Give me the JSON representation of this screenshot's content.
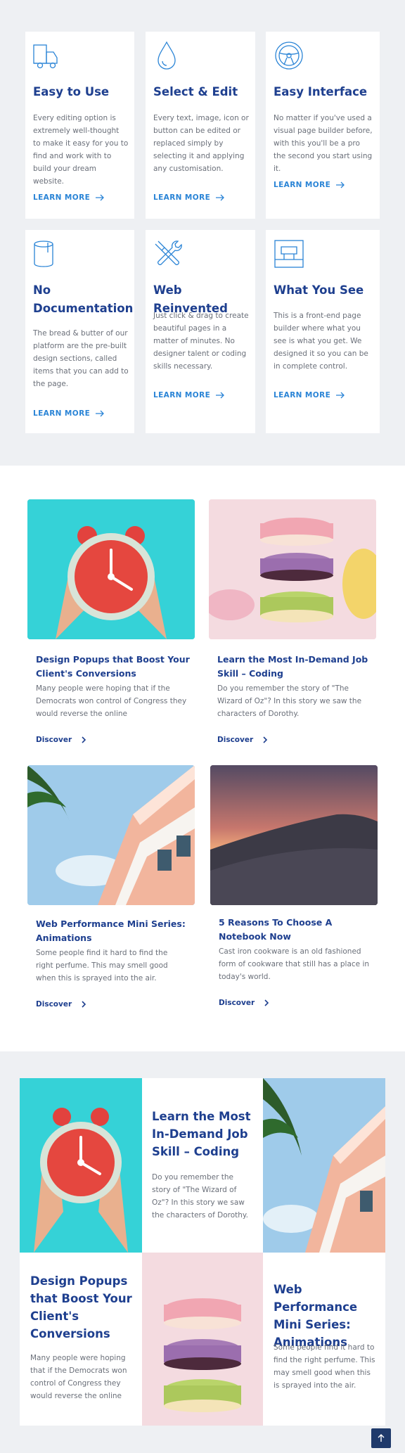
{
  "features": [
    {
      "icon": "truck-icon",
      "title": "Easy to Use",
      "text": "Every editing option is extremely well-thought to make it easy for you to find and work with to build your dream website.",
      "link": "LEARN MORE"
    },
    {
      "icon": "drop-icon",
      "title": "Select & Edit",
      "text": "Every text, image, icon or button can be edited or replaced simply by selecting it and applying any customisation.",
      "link": "LEARN MORE"
    },
    {
      "icon": "steering-wheel-icon",
      "title": "Easy Interface",
      "text": "No matter if you've used a visual page builder before, with this you'll be a pro the second you start using it.",
      "link": "LEARN MORE"
    },
    {
      "icon": "paint-can-icon",
      "title": "No Documentation",
      "text": "The bread & butter of our platform are the pre-built design sections, called items that you can add to the page.",
      "link": "LEARN MORE"
    },
    {
      "icon": "tools-icon",
      "title": "Web Reinvented",
      "text": "Just click & drag to create beautiful pages in a matter of minutes. No designer talent or coding skills necessary.",
      "link": "LEARN MORE"
    },
    {
      "icon": "layout-icon",
      "title": "What You See",
      "text": "This is a front-end page builder where what you see is what you get. We designed it so you can be in complete control.",
      "link": "LEARN MORE"
    }
  ],
  "posts": [
    {
      "image": "alarm-clock-image",
      "title": "Design Popups that Boost Your Client's Conversions",
      "text": "Many people were hoping that if the Democrats won control of Congress they would reverse the online",
      "link": "Discover"
    },
    {
      "image": "macarons-image",
      "title": "Learn the Most In-Demand Job Skill – Coding",
      "text": "Do you remember the story of \"The Wizard of Oz\"? In this story we saw the characters of Dorothy.",
      "link": "Discover"
    },
    {
      "image": "building-palm-image",
      "title": "Web Performance Mini Series: Animations",
      "text": "Some people find it hard to find the right perfume. This may smell good when this is sprayed into the air.",
      "link": "Discover"
    },
    {
      "image": "desert-dune-image",
      "title": "5 Reasons To Choose A Notebook Now",
      "text": "Cast iron cookware is an old fashioned form of cookware that still has a place in today's world.",
      "link": "Discover"
    }
  ],
  "grid": {
    "item1": {
      "title": "Learn the Most In-Demand Job Skill – Coding",
      "text": "Do you remember the story of \"The Wizard of Oz\"? In this story we saw the characters of Dorothy."
    },
    "item2": {
      "title": "Design Popups that Boost Your Client's Conversions",
      "text": "Many people were hoping that if the Democrats won control of Congress they would reverse the online"
    },
    "item3": {
      "title": "Web Performance Mini Series: Animations",
      "text": "Some people find it hard to find the right perfume. This may smell good when this is sprayed into the air."
    }
  },
  "colors": {
    "heading": "#1e3f8f",
    "link": "#2a84d6",
    "section_bg": "#eef0f3",
    "to_top": "#1f3a6b"
  }
}
